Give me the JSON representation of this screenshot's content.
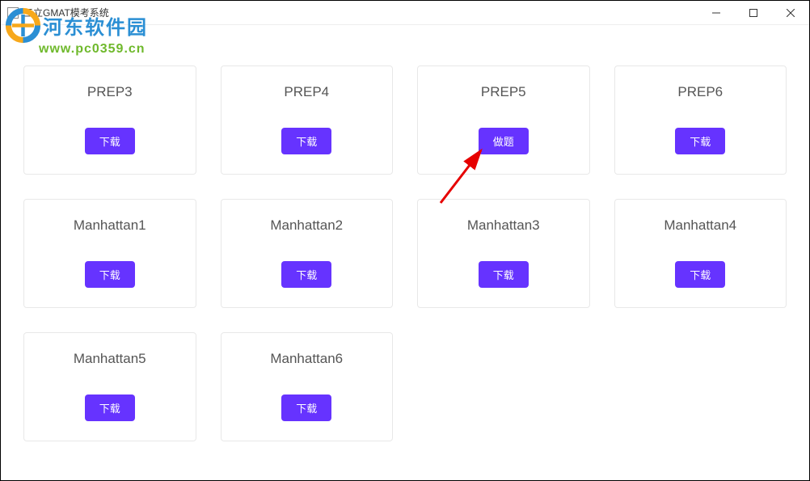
{
  "window": {
    "title": "三立GMAT模考系统"
  },
  "watermark": {
    "brand": "河东软件园",
    "url": "www.pc0359.cn"
  },
  "cards": [
    {
      "title": "PREP3",
      "button": "下载"
    },
    {
      "title": "PREP4",
      "button": "下载"
    },
    {
      "title": "PREP5",
      "button": "做题"
    },
    {
      "title": "PREP6",
      "button": "下载"
    },
    {
      "title": "Manhattan1",
      "button": "下载"
    },
    {
      "title": "Manhattan2",
      "button": "下载"
    },
    {
      "title": "Manhattan3",
      "button": "下载"
    },
    {
      "title": "Manhattan4",
      "button": "下载"
    },
    {
      "title": "Manhattan5",
      "button": "下载"
    },
    {
      "title": "Manhattan6",
      "button": "下载"
    }
  ]
}
